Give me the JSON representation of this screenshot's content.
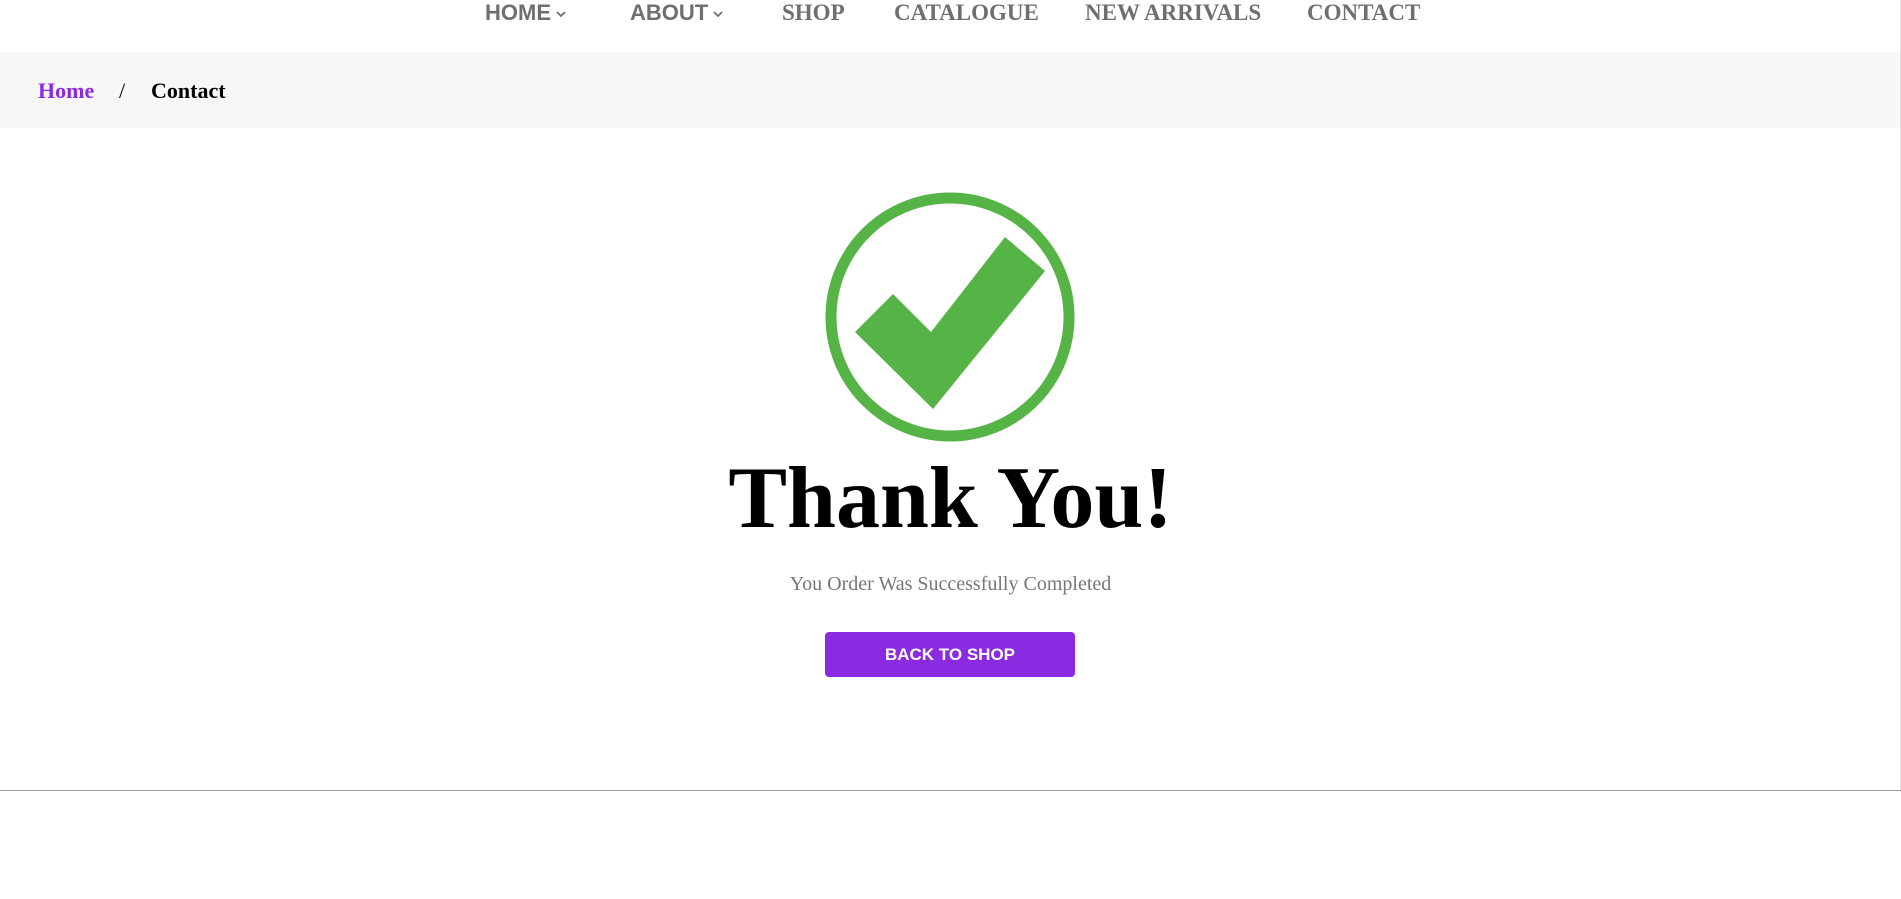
{
  "nav": {
    "items": [
      {
        "label": "HOME",
        "dropdown": true
      },
      {
        "label": "ABOUT",
        "dropdown": true
      },
      {
        "label": "SHOP",
        "dropdown": false
      },
      {
        "label": "CATALOGUE",
        "dropdown": false
      },
      {
        "label": "NEW ARRIVALS",
        "dropdown": false
      },
      {
        "label": "CONTACT",
        "dropdown": false
      }
    ]
  },
  "breadcrumb": {
    "home": "Home",
    "separator": "/",
    "current": "Contact"
  },
  "confirmation": {
    "icon": "check-circle-icon",
    "title": "Thank You!",
    "message": "You Order Was Successfully Completed",
    "button_label": "BACK TO SHOP"
  },
  "colors": {
    "accent": "#8a2be2",
    "success": "#56b447",
    "nav_text": "#6f6f6f",
    "breadcrumb_bg": "#f7f7f7"
  }
}
